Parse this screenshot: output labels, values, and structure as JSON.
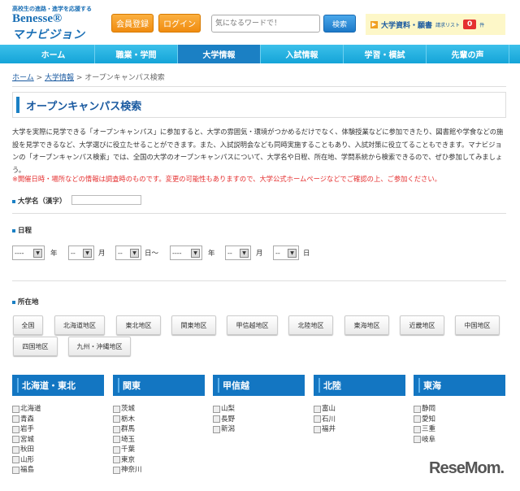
{
  "header": {
    "tagline": "高校生の進路・進学を応援する",
    "brand": "Benesse®",
    "brand_sub": "マナビジョン",
    "register": "会員登録",
    "login": "ログイン",
    "search_placeholder": "気になるワードで！",
    "search_button": "検索",
    "request_label": "大学資料・願書",
    "request_list": "請求リスト",
    "request_count": "0",
    "request_unit": "件"
  },
  "nav": [
    "ホーム",
    "職業・学問",
    "大学情報",
    "入試情報",
    "学習・模試",
    "先輩の声"
  ],
  "breadcrumb": [
    "ホーム",
    "大学情報",
    "オープンキャンパス検索"
  ],
  "page_title": "オープンキャンパス検索",
  "intro": "大学を実際に見学できる「オープンキャンパス」に参加すると、大学の雰囲気・環境がつかめるだけでなく、体験授業などに参加できたり、図書館や学食などの施設を見学できるなど、大学選びに役立たせることができます。また、入試説明会なども同時実施することもあり、入試対策に役立てることもできます。マナビジョンの「オープンキャンパス検索」では、全国の大学のオープンキャンパスについて、大学名や日程、所在地、学問系統から検索できるので、ぜひ参加してみましょう。",
  "warning": "※開催日時・場所などの情報は調査時のものです。変更の可能性もありますので、大学公式ホームページなどでご確認の上、ご参加ください。",
  "name_label": "大学名（漢字）",
  "schedule": {
    "label": "日程",
    "year_default": "----",
    "md_default": "--",
    "year": "年",
    "month": "月",
    "day_from": "日～",
    "day": "日"
  },
  "location": {
    "label": "所在地",
    "buttons": [
      "全国",
      "北海道地区",
      "東北地区",
      "関東地区",
      "甲信越地区",
      "北陸地区",
      "東海地区",
      "近畿地区",
      "中国地区",
      "四国地区",
      "九州・沖縄地区"
    ]
  },
  "regions": [
    {
      "name": "北海道・東北",
      "prefs": [
        "北海道",
        "青森",
        "岩手",
        "宮城",
        "秋田",
        "山形",
        "福島"
      ]
    },
    {
      "name": "関東",
      "prefs": [
        "茨城",
        "栃木",
        "群馬",
        "埼玉",
        "千葉",
        "東京",
        "神奈川"
      ]
    },
    {
      "name": "甲信越",
      "prefs": [
        "山梨",
        "長野",
        "新潟"
      ]
    },
    {
      "name": "北陸",
      "prefs": [
        "富山",
        "石川",
        "福井"
      ]
    },
    {
      "name": "東海",
      "prefs": [
        "静岡",
        "愛知",
        "三重",
        "岐阜"
      ]
    }
  ],
  "watermark": "ReseMom"
}
